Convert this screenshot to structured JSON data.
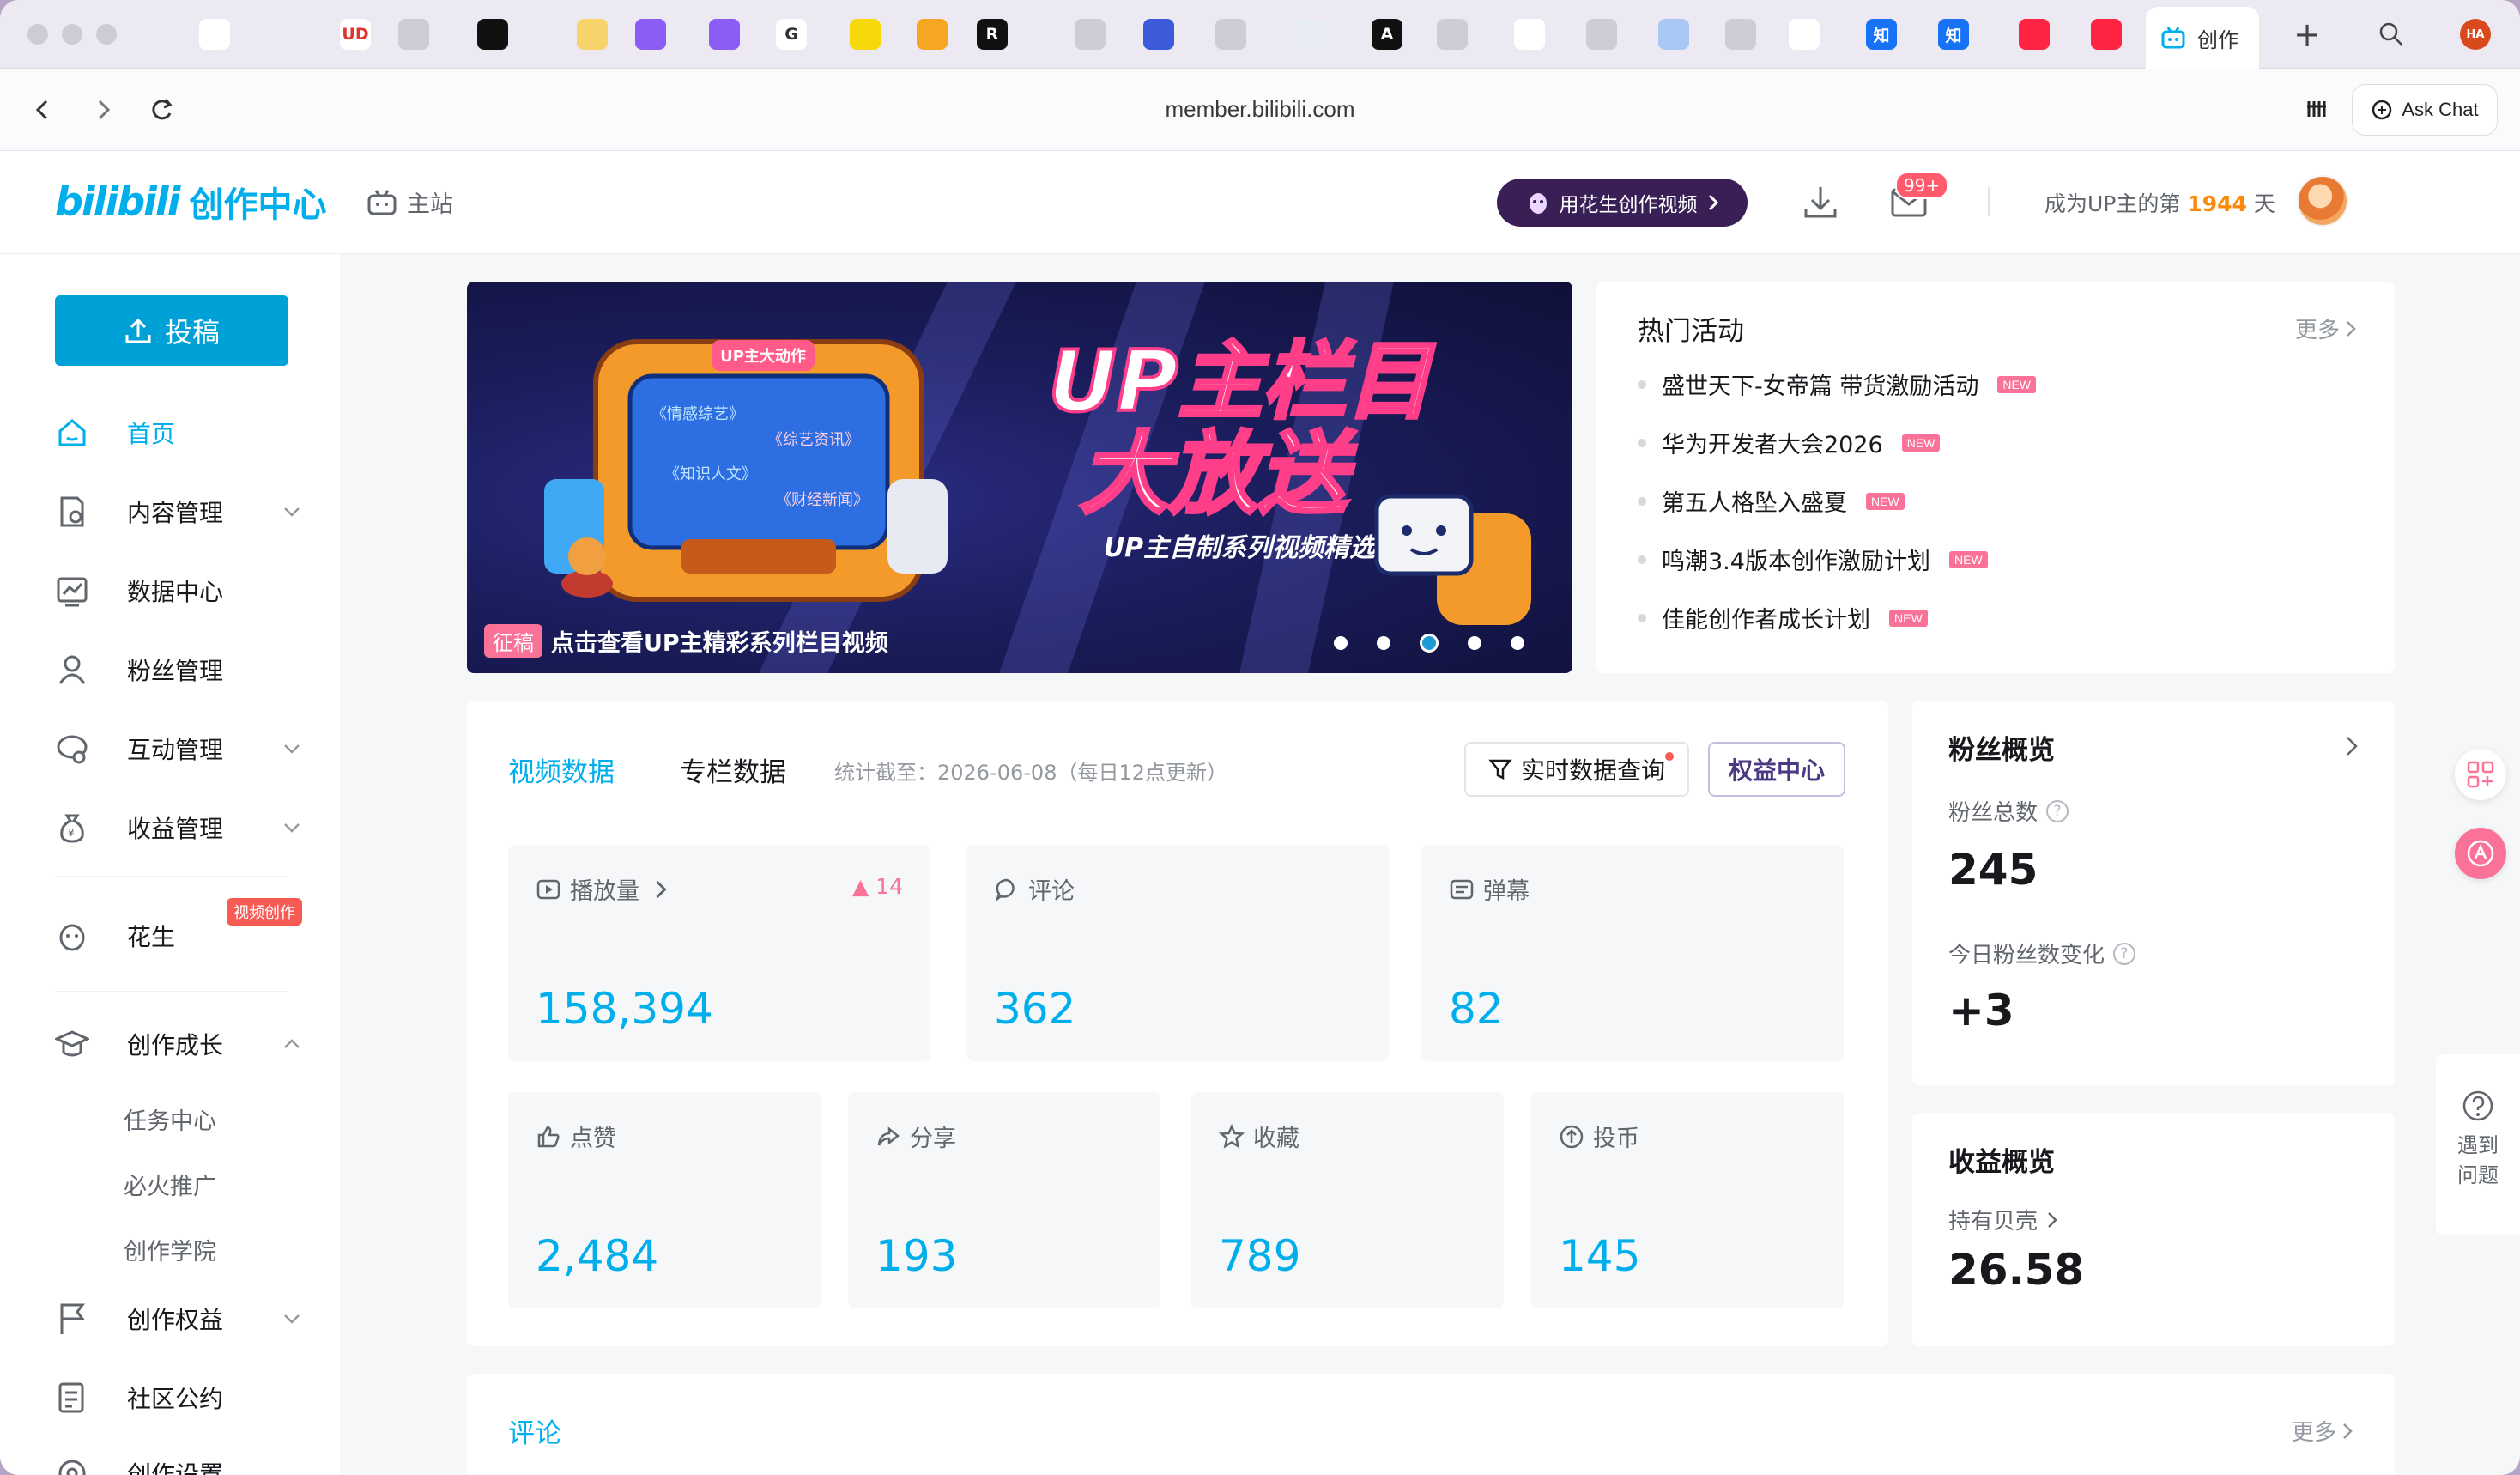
{
  "browser": {
    "url": "member.bilibili.com",
    "active_tab_title": "创作",
    "ask_chat": "Ask Chat",
    "avatar_initials": "HA",
    "tabs": [
      {
        "icon": "github-icon",
        "bg": "#ffffff",
        "glyph": ""
      },
      {
        "icon": "ud-icon",
        "bg": "#ffffff",
        "glyph": "UD"
      },
      {
        "icon": "placeholder-icon",
        "bg": "#d0ccd6",
        "glyph": ""
      },
      {
        "icon": "pulse-icon",
        "bg": "#111111",
        "glyph": ""
      },
      {
        "icon": "weather-icon",
        "bg": "#f7d46b",
        "glyph": ""
      },
      {
        "icon": "app-icon",
        "bg": "#8b5cf6",
        "glyph": ""
      },
      {
        "icon": "app-icon",
        "bg": "#8b5cf6",
        "glyph": ""
      },
      {
        "icon": "google-icon",
        "bg": "#ffffff",
        "glyph": "G"
      },
      {
        "icon": "yellow-app-icon",
        "bg": "#f5d90a",
        "glyph": ""
      },
      {
        "icon": "shield-app-icon",
        "bg": "#f5a623",
        "glyph": ""
      },
      {
        "icon": "r-app-icon",
        "bg": "#111111",
        "glyph": "R"
      },
      {
        "icon": "placeholder-icon",
        "bg": "#d0ccd6",
        "glyph": ""
      },
      {
        "icon": "doc-app-icon",
        "bg": "#3b5bdb",
        "glyph": ""
      },
      {
        "icon": "placeholder-icon",
        "bg": "#d0ccd6",
        "glyph": ""
      },
      {
        "icon": "cloud-app-icon",
        "bg": "#e8ecf3",
        "glyph": ""
      },
      {
        "icon": "a-app-icon",
        "bg": "#111111",
        "glyph": "A"
      },
      {
        "icon": "placeholder-icon",
        "bg": "#d0ccd6",
        "glyph": ""
      },
      {
        "icon": "github-icon",
        "bg": "#ffffff",
        "glyph": ""
      },
      {
        "icon": "placeholder-icon",
        "bg": "#d0ccd6",
        "glyph": ""
      },
      {
        "icon": "anime-app-icon",
        "bg": "#a9c7f5",
        "glyph": ""
      },
      {
        "icon": "placeholder-icon",
        "bg": "#d0ccd6",
        "glyph": ""
      },
      {
        "icon": "github-icon",
        "bg": "#ffffff",
        "glyph": ""
      },
      {
        "icon": "zhihu-icon",
        "bg": "#1772f6",
        "glyph": "知"
      },
      {
        "icon": "zhihu-icon",
        "bg": "#1772f6",
        "glyph": "知"
      },
      {
        "icon": "red-app-icon",
        "bg": "#ff2442",
        "glyph": ""
      },
      {
        "icon": "red-app-icon",
        "bg": "#ff2442",
        "glyph": ""
      },
      {
        "icon": "bilibili-tab-icon",
        "bg": "#ffffff",
        "glyph": ""
      }
    ]
  },
  "header": {
    "logo_b": "bilibili",
    "logo_text": "创作中心",
    "main_site": "主站",
    "peanut_button": "用花生创作视频",
    "messages_badge": "99+",
    "up_days_prefix": "成为UP主的第",
    "up_days_value": "1944",
    "up_days_suffix": "天"
  },
  "sidebar": {
    "upload": "投稿",
    "items": [
      {
        "label": "首页",
        "active": true
      },
      {
        "label": "内容管理"
      },
      {
        "label": "数据中心"
      },
      {
        "label": "粉丝管理"
      },
      {
        "label": "互动管理"
      },
      {
        "label": "收益管理"
      },
      {
        "label": "花生",
        "tag": "视频创作"
      },
      {
        "label": "创作成长"
      },
      {
        "label": "创作权益"
      },
      {
        "label": "社区公约"
      },
      {
        "label": "创作设置"
      }
    ],
    "growth_sub": [
      "任务中心",
      "必火推广",
      "创作学院"
    ]
  },
  "banner": {
    "tag": "征稿",
    "caption": "点击查看UP主精彩系列栏目视频",
    "headline_1": "UP主栏目",
    "headline_2": "大放送",
    "subline": "UP主自制系列视频精选",
    "tv_label": "UP主大动作",
    "tv_items": [
      "《情感综艺》",
      "《综艺资讯》",
      "《知识人文》",
      "《财经新闻》"
    ],
    "active_slide": 3
  },
  "hot_activities": {
    "title": "热门活动",
    "more": "更多",
    "new_tag": "NEW",
    "items": [
      "盛世天下-女帝篇 带货激励活动",
      "华为开发者大会2026",
      "第五人格坠入盛夏",
      "鸣潮3.4版本创作激励计划",
      "佳能创作者成长计划"
    ]
  },
  "video_data": {
    "tab_video": "视频数据",
    "tab_column": "专栏数据",
    "stat_date": "统计截至：2026-06-08（每日12点更新）",
    "realtime_button": "实时数据查询",
    "rights_button": "权益中心",
    "stats": [
      {
        "label": "播放量",
        "value": "158,394",
        "delta": "14",
        "icon": "play-icon"
      },
      {
        "label": "评论",
        "value": "362",
        "icon": "comment-icon"
      },
      {
        "label": "弹幕",
        "value": "82",
        "icon": "danmaku-icon"
      },
      {
        "label": "点赞",
        "value": "2,484",
        "icon": "like-icon"
      },
      {
        "label": "分享",
        "value": "193",
        "icon": "share-icon"
      },
      {
        "label": "收藏",
        "value": "789",
        "icon": "star-icon"
      },
      {
        "label": "投币",
        "value": "145",
        "icon": "coin-icon"
      }
    ]
  },
  "fans_overview": {
    "title": "粉丝概览",
    "total_label": "粉丝总数",
    "total_value": "245",
    "today_label": "今日粉丝数变化",
    "today_value": "+3"
  },
  "income_overview": {
    "title": "收益概览",
    "shells_label": "持有贝壳",
    "shells_value": "26.58"
  },
  "comments": {
    "title": "评论",
    "more": "更多"
  },
  "help": {
    "label_1": "遇到",
    "label_2": "问题"
  },
  "colors": {
    "brand": "#00aeec",
    "pink": "#fb7299",
    "peanut": "#3a1f57",
    "days": "#fb8a0c"
  }
}
